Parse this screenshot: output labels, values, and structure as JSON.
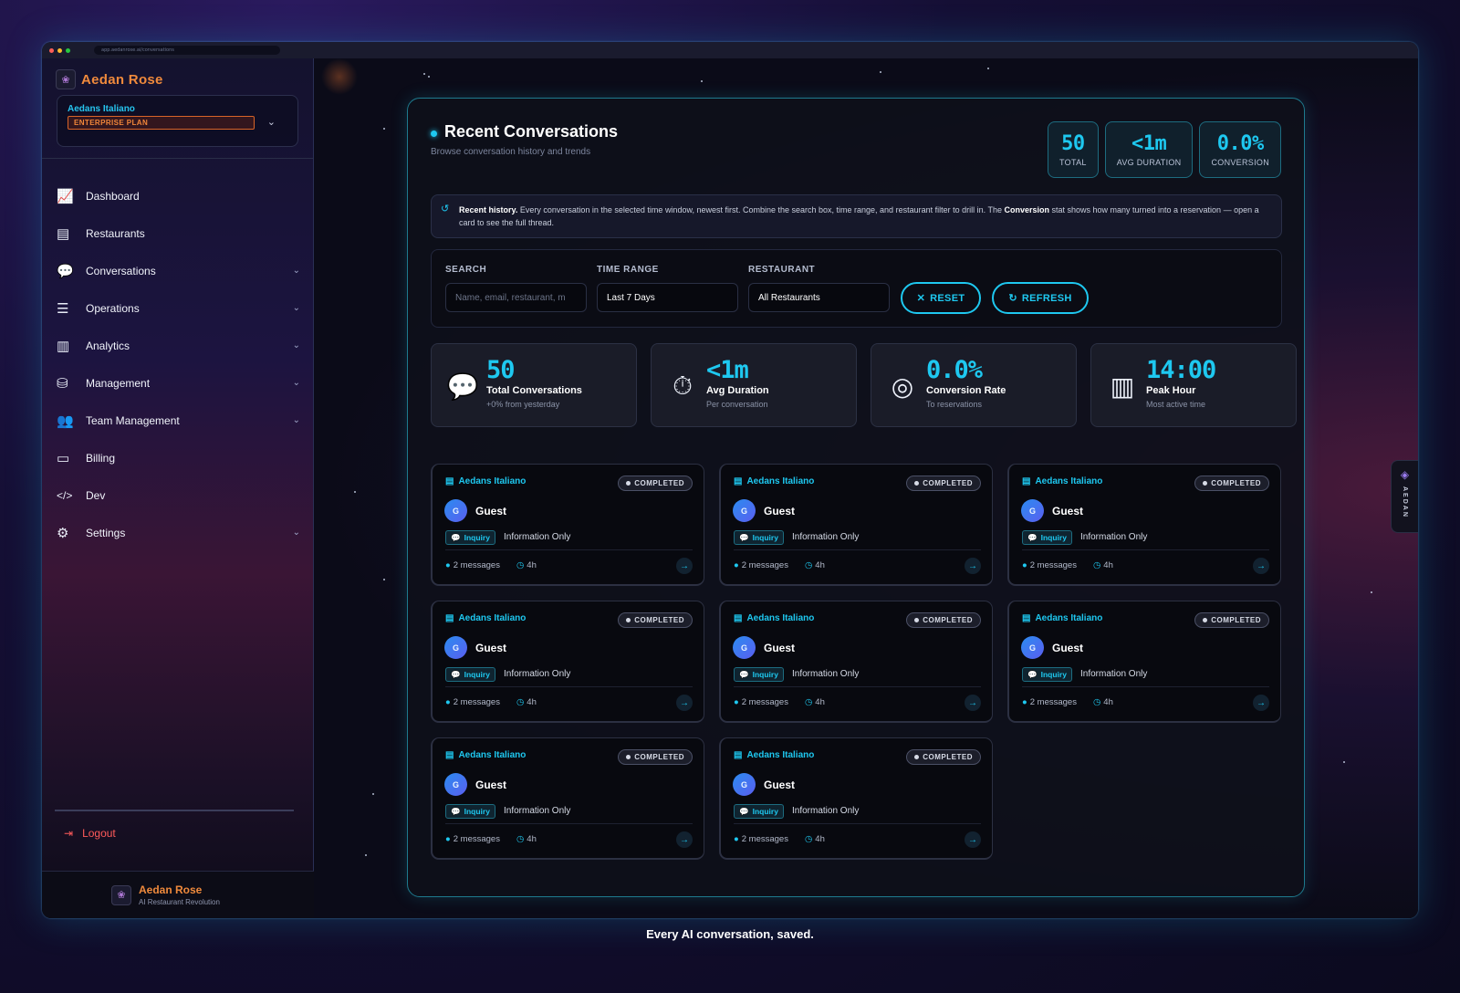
{
  "browser": {
    "url": "app.aedanrose.ai/conversations"
  },
  "brand": {
    "name": "Aedan Rose",
    "logo_icon": "rose-logo-icon"
  },
  "org": {
    "name": "Aedans Italiano",
    "plan": "ENTERPRISE PLAN"
  },
  "sidebar": {
    "items": [
      {
        "label": "Dashboard",
        "icon": "chart-line-icon",
        "has_chevron": false
      },
      {
        "label": "Restaurants",
        "icon": "store-icon",
        "has_chevron": false
      },
      {
        "label": "Conversations",
        "icon": "chat-bubbles-icon",
        "has_chevron": true
      },
      {
        "label": "Operations",
        "icon": "checklist-icon",
        "has_chevron": true
      },
      {
        "label": "Analytics",
        "icon": "bar-chart-icon",
        "has_chevron": true
      },
      {
        "label": "Management",
        "icon": "database-icon",
        "has_chevron": true
      },
      {
        "label": "Team Management",
        "icon": "users-icon",
        "has_chevron": true
      },
      {
        "label": "Billing",
        "icon": "credit-card-icon",
        "has_chevron": false
      },
      {
        "label": "Dev",
        "icon": "code-icon",
        "has_chevron": false
      },
      {
        "label": "Settings",
        "icon": "gear-icon",
        "has_chevron": true
      }
    ],
    "logout_label": "Logout"
  },
  "footer": {
    "name": "Aedan Rose",
    "tagline": "AI Restaurant Revolution"
  },
  "page": {
    "title": "Recent Conversations",
    "subtitle": "Browse conversation history and trends",
    "stats": [
      {
        "value": "50",
        "label": "TOTAL"
      },
      {
        "value": "<1m",
        "label": "AVG DURATION"
      },
      {
        "value": "0.0%",
        "label": "CONVERSION"
      }
    ],
    "notice": {
      "lead": "Recent history.",
      "text1": " Every conversation in the selected time window, newest first. Combine the search box, time range, and restaurant filter to drill in. The ",
      "strong": "Conversion",
      "text2": " stat shows how many turned into a reservation — open a card to see the full thread."
    }
  },
  "filters": {
    "search_label": "SEARCH",
    "search_placeholder": "Name, email, restaurant, m",
    "time_label": "TIME RANGE",
    "time_value": "Last 7 Days",
    "restaurant_label": "RESTAURANT",
    "restaurant_value": "All Restaurants",
    "reset_label": "RESET",
    "refresh_label": "REFRESH"
  },
  "kpis": [
    {
      "icon": "chat-bubbles-icon",
      "value": "50",
      "title": "Total Conversations",
      "sub": "+0% from yesterday"
    },
    {
      "icon": "stopwatch-icon",
      "value": "<1m",
      "title": "Avg Duration",
      "sub": "Per conversation"
    },
    {
      "icon": "target-icon",
      "value": "0.0%",
      "title": "Conversion Rate",
      "sub": "To reservations"
    },
    {
      "icon": "bar-chart-icon",
      "value": "14:00",
      "title": "Peak Hour",
      "sub": "Most active time"
    }
  ],
  "conversations": [
    {
      "restaurant": "Aedans Italiano",
      "status": "COMPLETED",
      "avatar": "G",
      "name": "Guest",
      "tag": "Inquiry",
      "type": "Information Only",
      "messages": "2 messages",
      "age": "4h"
    },
    {
      "restaurant": "Aedans Italiano",
      "status": "COMPLETED",
      "avatar": "G",
      "name": "Guest",
      "tag": "Inquiry",
      "type": "Information Only",
      "messages": "2 messages",
      "age": "4h"
    },
    {
      "restaurant": "Aedans Italiano",
      "status": "COMPLETED",
      "avatar": "G",
      "name": "Guest",
      "tag": "Inquiry",
      "type": "Information Only",
      "messages": "2 messages",
      "age": "4h"
    },
    {
      "restaurant": "Aedans Italiano",
      "status": "COMPLETED",
      "avatar": "G",
      "name": "Guest",
      "tag": "Inquiry",
      "type": "Information Only",
      "messages": "2 messages",
      "age": "4h"
    },
    {
      "restaurant": "Aedans Italiano",
      "status": "COMPLETED",
      "avatar": "G",
      "name": "Guest",
      "tag": "Inquiry",
      "type": "Information Only",
      "messages": "2 messages",
      "age": "4h"
    },
    {
      "restaurant": "Aedans Italiano",
      "status": "COMPLETED",
      "avatar": "G",
      "name": "Guest",
      "tag": "Inquiry",
      "type": "Information Only",
      "messages": "2 messages",
      "age": "4h"
    },
    {
      "restaurant": "Aedans Italiano",
      "status": "COMPLETED",
      "avatar": "G",
      "name": "Guest",
      "tag": "Inquiry",
      "type": "Information Only",
      "messages": "2 messages",
      "age": "4h"
    },
    {
      "restaurant": "Aedans Italiano",
      "status": "COMPLETED",
      "avatar": "G",
      "name": "Guest",
      "tag": "Inquiry",
      "type": "Information Only",
      "messages": "2 messages",
      "age": "4h"
    }
  ],
  "side_tab": {
    "label": "AEDAN",
    "icon": "diamond-icon"
  },
  "caption": "Every AI conversation, saved.",
  "colors": {
    "accent": "#1ec8f0",
    "brand": "#f08a3c",
    "danger": "#ff5a5a"
  }
}
